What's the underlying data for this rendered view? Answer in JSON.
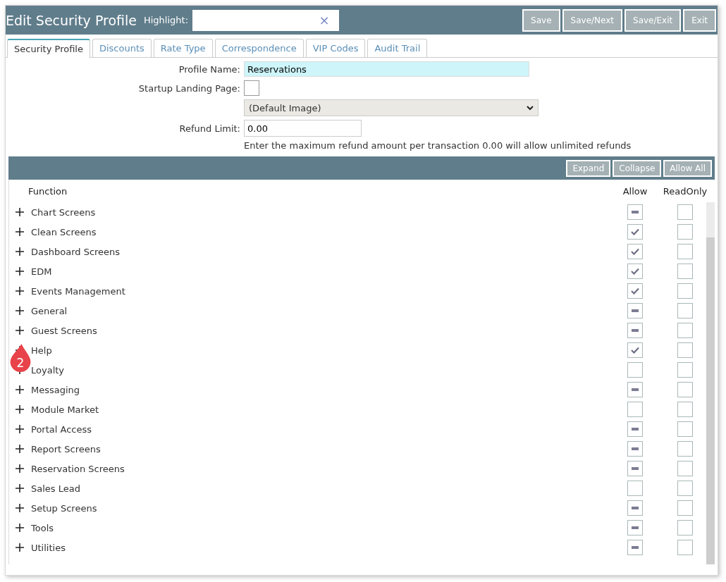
{
  "window": {
    "title": "Edit Security Profile"
  },
  "highlight": {
    "label": "Highlight:",
    "clear": "×"
  },
  "header_buttons": [
    "Save",
    "Save/Next",
    "Save/Exit",
    "Exit"
  ],
  "tabs": [
    {
      "label": "Security Profile",
      "selected": true
    },
    {
      "label": "Discounts",
      "selected": false
    },
    {
      "label": "Rate Type",
      "selected": false
    },
    {
      "label": "Correspondence",
      "selected": false
    },
    {
      "label": "VIP Codes",
      "selected": false
    },
    {
      "label": "Audit Trail",
      "selected": false
    }
  ],
  "form": {
    "profile_name": {
      "label": "Profile Name:",
      "value": "Reservations"
    },
    "startup_landing_page": {
      "label": "Startup Landing Page:",
      "checked": false,
      "select": "(Default Image)"
    },
    "refund_limit": {
      "label": "Refund Limit:",
      "value": "0.00",
      "hint": "Enter the maximum refund amount per transaction 0.00 will allow unlimited refunds"
    }
  },
  "grid_buttons": [
    "Expand",
    "Collapse",
    "Allow All"
  ],
  "columns": [
    "Function",
    "Allow",
    "ReadOnly"
  ],
  "rows": [
    {
      "name": "Chart Screens",
      "checked": false,
      "partial": true,
      "readonly": false
    },
    {
      "name": "Clean Screens",
      "checked": true,
      "partial": false,
      "readonly": false
    },
    {
      "name": "Dashboard Screens",
      "checked": true,
      "partial": false,
      "readonly": false
    },
    {
      "name": "EDM",
      "checked": true,
      "partial": false,
      "readonly": false
    },
    {
      "name": "Events Management",
      "checked": true,
      "partial": false,
      "readonly": false
    },
    {
      "name": "General",
      "checked": false,
      "partial": true,
      "readonly": false
    },
    {
      "name": "Guest Screens",
      "checked": false,
      "partial": true,
      "readonly": false
    },
    {
      "name": "Help",
      "checked": true,
      "partial": false,
      "readonly": false
    },
    {
      "name": "Loyalty",
      "checked": false,
      "partial": false,
      "readonly": false
    },
    {
      "name": "Messaging",
      "checked": false,
      "partial": true,
      "readonly": false
    },
    {
      "name": "Module Market",
      "checked": false,
      "partial": false,
      "readonly": false
    },
    {
      "name": "Portal Access",
      "checked": false,
      "partial": true,
      "readonly": false
    },
    {
      "name": "Report Screens",
      "checked": false,
      "partial": true,
      "readonly": false
    },
    {
      "name": "Reservation Screens",
      "checked": false,
      "partial": true,
      "readonly": false
    },
    {
      "name": "Sales Lead",
      "checked": false,
      "partial": false,
      "readonly": false
    },
    {
      "name": "Setup Screens",
      "checked": false,
      "partial": true,
      "readonly": false
    },
    {
      "name": "Tools",
      "checked": false,
      "partial": true,
      "readonly": false
    },
    {
      "name": "Utilities",
      "checked": false,
      "partial": true,
      "readonly": false
    }
  ],
  "callout": {
    "label": "2"
  }
}
